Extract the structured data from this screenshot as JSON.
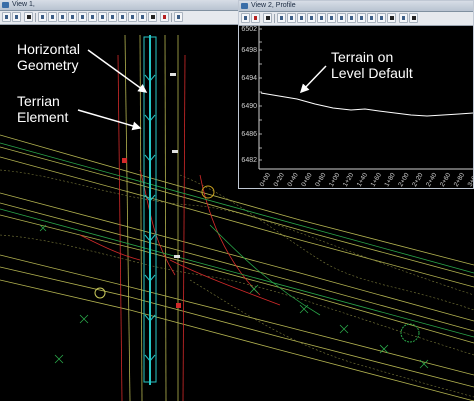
{
  "view1": {
    "title": "View 1,"
  },
  "view2": {
    "title": "View 2, Profile",
    "y_labels": [
      "6502",
      "6498",
      "6494",
      "6490",
      "6486",
      "6482"
    ],
    "x_labels": [
      "0+00",
      "0+20",
      "0+40",
      "0+60",
      "0+80",
      "1+00",
      "1+20",
      "1+40",
      "1+60",
      "1+80",
      "2+00",
      "2+20",
      "2+40",
      "2+60",
      "2+80",
      "3+00"
    ]
  },
  "annotations": {
    "horizontal_geometry": [
      "Horizontal",
      "Geometry"
    ],
    "terrian_element": [
      "Terrian",
      "Element"
    ],
    "terrain_on_level": [
      "Terrain on",
      "Level Default"
    ]
  },
  "colors": {
    "background": "#000000",
    "alignment": "#27c7c7",
    "road_lines": "#c8c85a",
    "red_lines": "#d22a2a",
    "green_lines": "#2aa84a",
    "profile_line": "#ffffff",
    "annotation_text": "#ffffff"
  }
}
